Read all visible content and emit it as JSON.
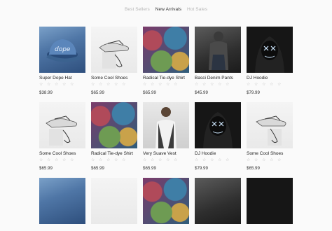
{
  "tabs": [
    {
      "label": "Best Sellers",
      "active": false
    },
    {
      "label": "New Arrivals",
      "active": true
    },
    {
      "label": "Hot Sales",
      "active": false
    }
  ],
  "products": [
    [
      {
        "name": "Super Dope Hat",
        "stars": "☆ ☆ ☆ ☆ ☆",
        "price": "$38.99",
        "image": "hat"
      },
      {
        "name": "Some Cool Shoes",
        "stars": "☆ ☆ ☆ ☆ ☆",
        "price": "$65.99",
        "image": "shoes"
      },
      {
        "name": "Radical Tie-dye Shirt",
        "stars": "☆ ☆ ☆ ☆ ☆",
        "price": "$65.99",
        "image": "tiedye"
      },
      {
        "name": "Basci Denim Pants",
        "stars": "☆ ☆ ☆ ☆ ☆",
        "price": "$45.99",
        "image": "denim"
      },
      {
        "name": "DJ Hoodie",
        "stars": "☆ ☆ ☆ ☆ ☆",
        "price": "$79.99",
        "image": "hoodie"
      }
    ],
    [
      {
        "name": "Some Cool Shoes",
        "stars": "☆ ☆ ☆ ☆ ☆",
        "price": "$65.99",
        "image": "shoes"
      },
      {
        "name": "Radical Tie-dye Shirt",
        "stars": "☆ ☆ ☆ ☆ ☆",
        "price": "$65.99",
        "image": "tiedye"
      },
      {
        "name": "Very Suave Vest",
        "stars": "☆ ☆ ☆ ☆ ☆",
        "price": "$65.99",
        "image": "vest"
      },
      {
        "name": "DJ Hoodie",
        "stars": "☆ ☆ ☆ ☆ ☆",
        "price": "$79.99",
        "image": "hoodie"
      },
      {
        "name": "Some Cool Shoes",
        "stars": "☆ ☆ ☆ ☆ ☆",
        "price": "$65.99",
        "image": "shoes"
      }
    ]
  ],
  "colors": {
    "background": "#fafafa",
    "tab_active": "#333333",
    "tab_inactive": "#b5b5b5",
    "star": "#bdbdbd"
  }
}
